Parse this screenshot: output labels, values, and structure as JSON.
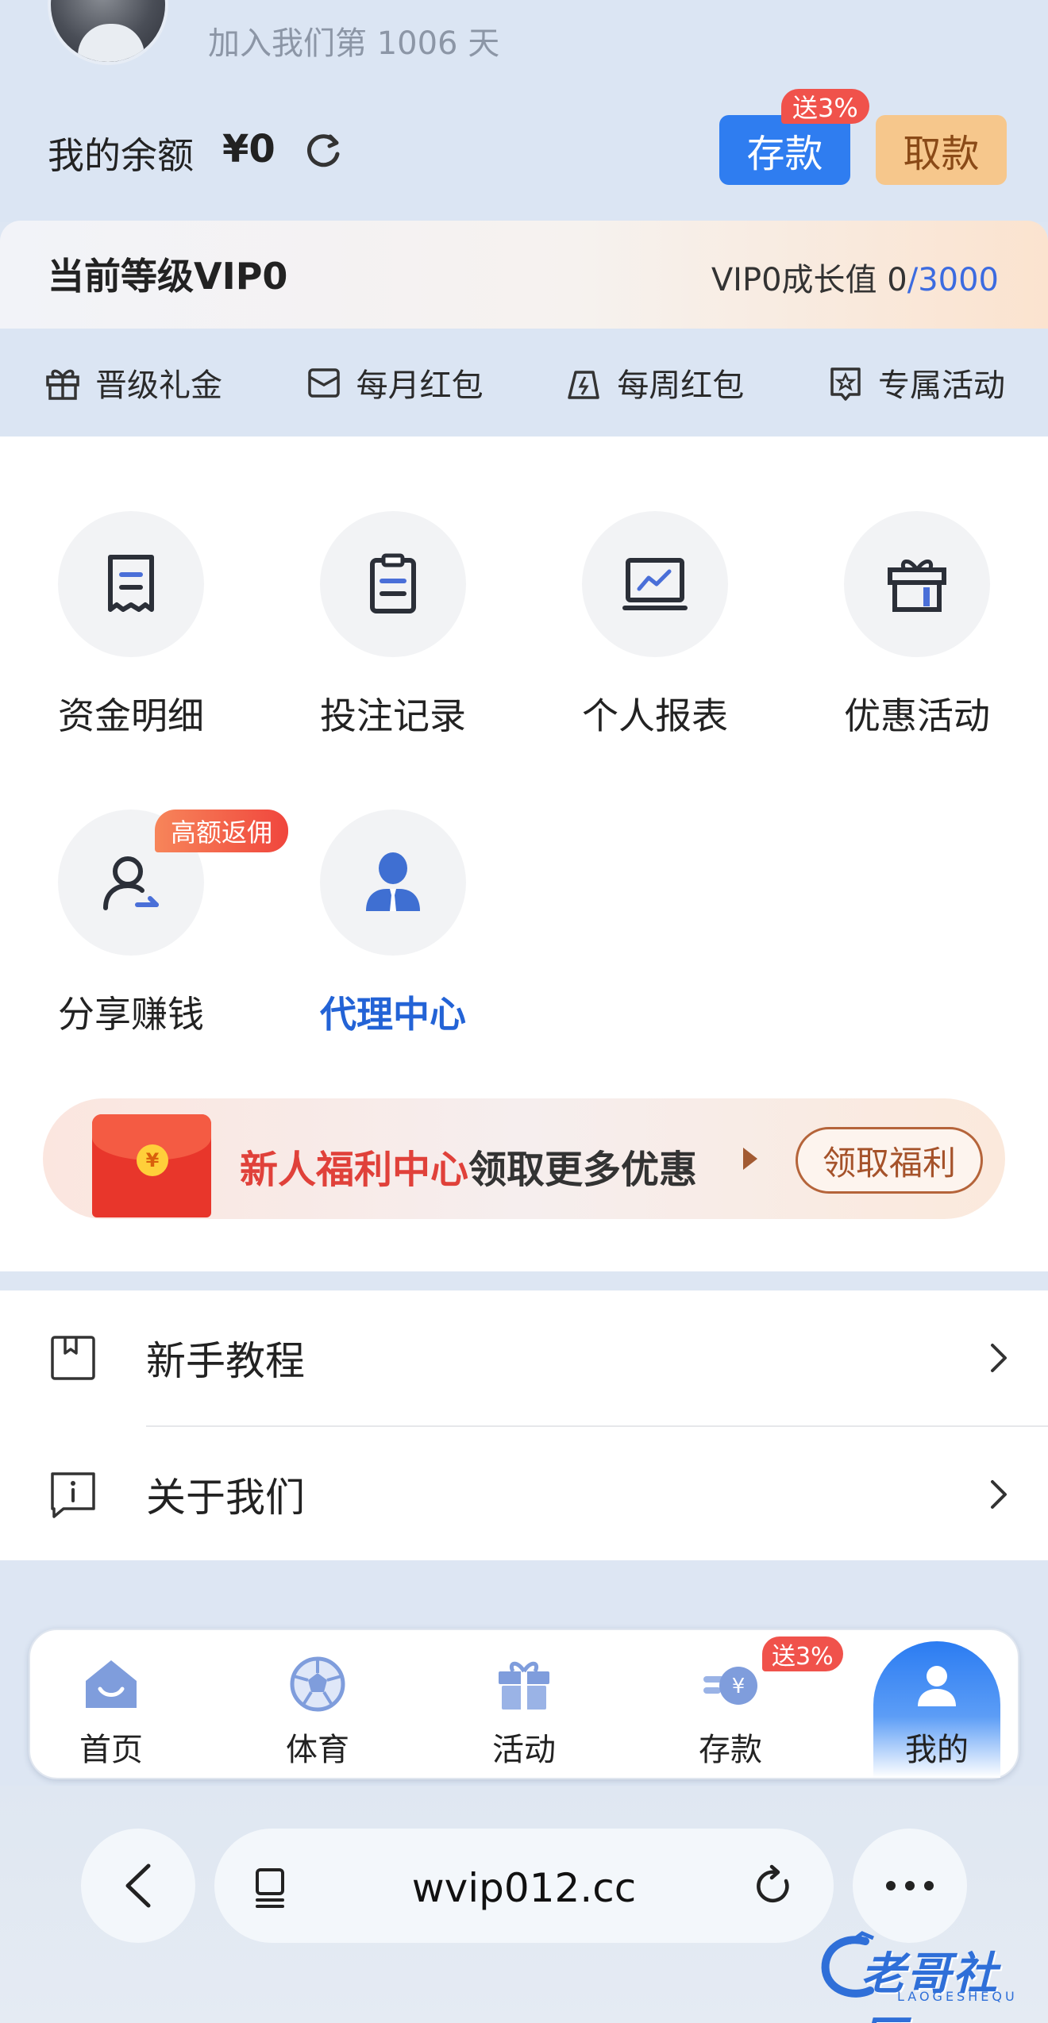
{
  "profile": {
    "join_text": "加入我们第 1006 天"
  },
  "balance": {
    "label": "我的余额",
    "value": "¥0",
    "deposit_label": "存款",
    "deposit_badge": "送3%",
    "withdraw_label": "取款"
  },
  "vip": {
    "level_text": "当前等级VIP0",
    "growth_prefix": "VIP0成长值 0",
    "growth_target": "/3000",
    "perks": [
      {
        "label": "晋级礼金",
        "icon": "gift-icon"
      },
      {
        "label": "每月红包",
        "icon": "envelope-icon"
      },
      {
        "label": "每周红包",
        "icon": "weekly-bag-icon"
      },
      {
        "label": "专属活动",
        "icon": "star-ticket-icon"
      }
    ]
  },
  "grid": [
    {
      "label": "资金明细",
      "icon": "receipt-icon"
    },
    {
      "label": "投注记录",
      "icon": "clipboard-icon"
    },
    {
      "label": "个人报表",
      "icon": "chart-monitor-icon"
    },
    {
      "label": "优惠活动",
      "icon": "gift-box-icon"
    },
    {
      "label": "分享赚钱",
      "icon": "share-user-icon",
      "badge": "高额返佣"
    },
    {
      "label": "代理中心",
      "icon": "agent-icon"
    }
  ],
  "promo": {
    "red_part": "新人福利中心",
    "dark_part": "领取更多优惠",
    "button": "领取福利"
  },
  "list": [
    {
      "label": "新手教程",
      "icon": "bookmark-book-icon"
    },
    {
      "label": "关于我们",
      "icon": "info-chat-icon"
    }
  ],
  "tabbar": {
    "items": [
      {
        "label": "首页",
        "icon": "home-icon"
      },
      {
        "label": "体育",
        "icon": "soccer-ball-icon"
      },
      {
        "label": "活动",
        "icon": "gift-icon"
      },
      {
        "label": "存款",
        "icon": "deposit-coin-icon"
      },
      {
        "label": "我的",
        "icon": "user-icon"
      }
    ],
    "deposit_badge": "送3%",
    "active_index": 4
  },
  "browser": {
    "url": "wvip012.cc"
  },
  "watermark": {
    "text": "老哥社区",
    "sub": "LAOGESHEQU"
  },
  "colors": {
    "accent_blue": "#2f7df0",
    "withdraw_bg": "#f6c78c",
    "badge_red": "#f0524b",
    "agent_blue": "#2363d6",
    "page_bg": "#dde6f3"
  }
}
